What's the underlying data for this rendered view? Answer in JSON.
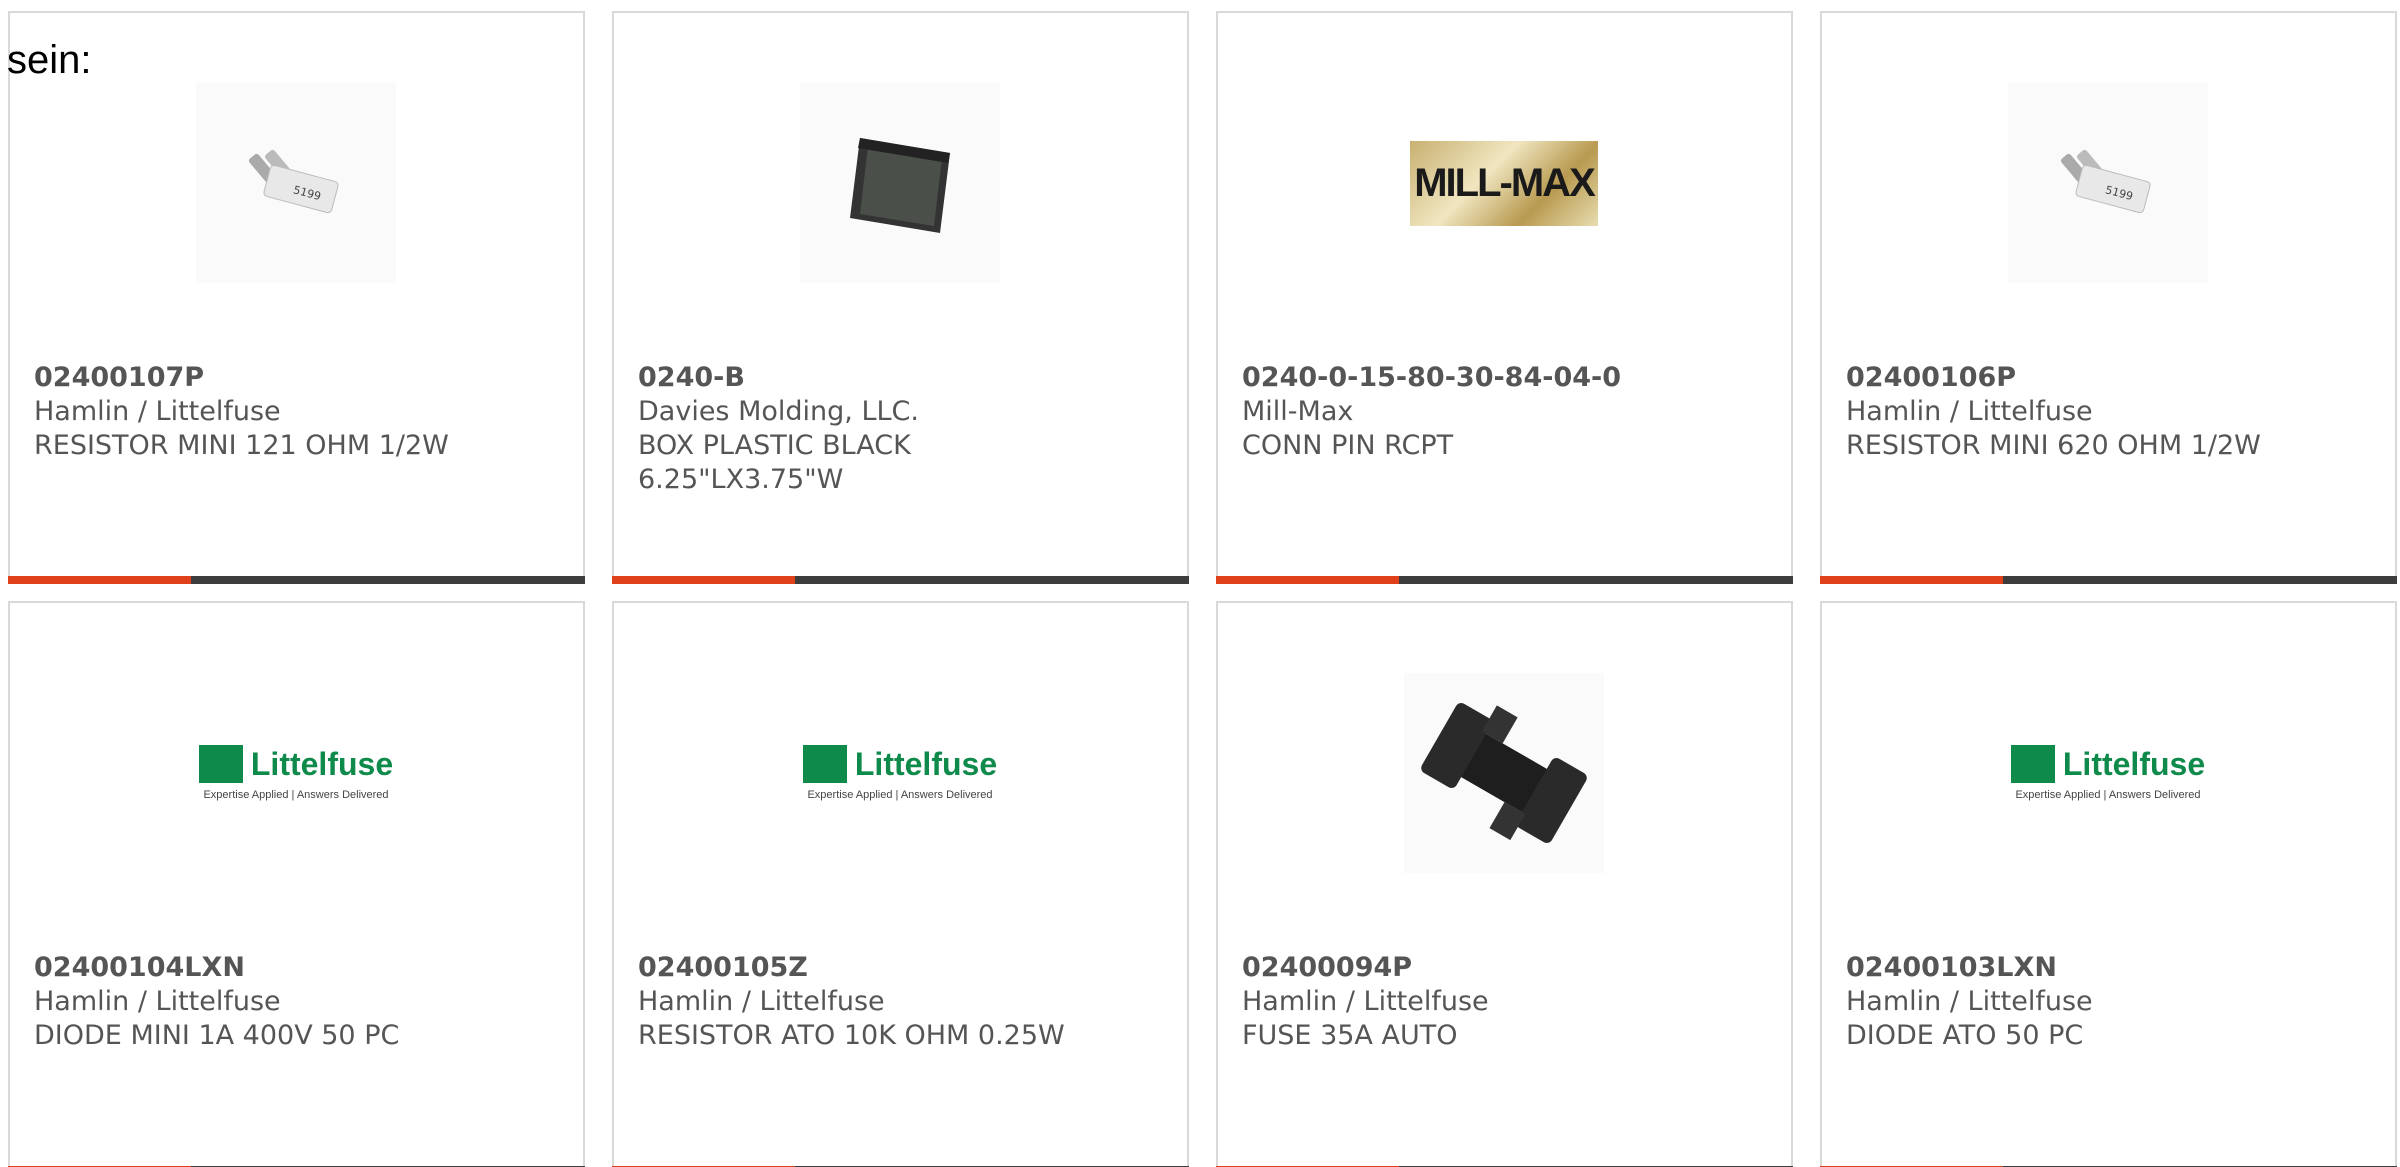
{
  "intro": {
    "text": "sein:"
  },
  "logos": {
    "littelfuse_word": "Littelfuse",
    "littelfuse_tag": "Expertise Applied | Answers Delivered",
    "millmax_word": "MILL-MAX"
  },
  "colors": {
    "accent": "#e0401a",
    "bar": "#3d3d3d",
    "border": "#d9d9d9",
    "littelfuse_green": "#0e8a4a"
  },
  "cards": [
    {
      "part": "02400107P",
      "manufacturer": "Hamlin / Littelfuse",
      "description": "RESISTOR MINI 121 OHM 1/2W",
      "image": "mini-blade-part-photo"
    },
    {
      "part": "0240-B",
      "manufacturer": "Davies Molding, LLC.",
      "description": "BOX PLASTIC BLACK\n6.25\"LX3.75\"W",
      "image": "black-box-photo"
    },
    {
      "part": "0240-0-15-80-30-84-04-0",
      "manufacturer": "Mill-Max",
      "description": "CONN PIN RCPT",
      "image": "mill-max-logo"
    },
    {
      "part": "02400106P",
      "manufacturer": "Hamlin / Littelfuse",
      "description": "RESISTOR MINI 620 OHM 1/2W",
      "image": "mini-blade-part-photo"
    },
    {
      "part": "02400104LXN",
      "manufacturer": "Hamlin / Littelfuse",
      "description": "DIODE MINI 1A 400V 50 PC",
      "image": "littelfuse-logo"
    },
    {
      "part": "02400105Z",
      "manufacturer": "Hamlin / Littelfuse",
      "description": "RESISTOR ATO 10K OHM 0.25W",
      "image": "littelfuse-logo"
    },
    {
      "part": "02400094P",
      "manufacturer": "Hamlin / Littelfuse",
      "description": "FUSE 35A AUTO",
      "image": "fuse-holder-photo"
    },
    {
      "part": "02400103LXN",
      "manufacturer": "Hamlin / Littelfuse",
      "description": "DIODE ATO 50 PC",
      "image": "littelfuse-logo"
    }
  ]
}
